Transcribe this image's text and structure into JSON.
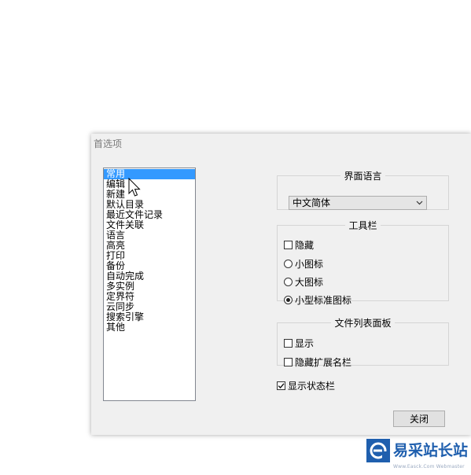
{
  "dialog": {
    "title": "首选项"
  },
  "categories": [
    "常用",
    "编辑",
    "新建",
    "默认目录",
    "最近文件记录",
    "文件关联",
    "语言",
    "高亮",
    "打印",
    "备份",
    "自动完成",
    "多实例",
    "定界符",
    "云同步",
    "搜索引擎",
    "其他"
  ],
  "selected_category": "常用",
  "language": {
    "legend": "界面语言",
    "value": "中文简体"
  },
  "toolbar": {
    "legend": "工具栏",
    "hide_label": "隐藏",
    "hide_checked": false,
    "options": [
      "小图标",
      "大图标",
      "小型标准图标"
    ],
    "selected": "小型标准图标"
  },
  "file_panel": {
    "legend": "文件列表面板",
    "show_label": "显示",
    "show_checked": false,
    "hide_ext_label": "隐藏扩展名栏",
    "hide_ext_checked": false
  },
  "status_bar": {
    "label": "显示状态栏",
    "checked": true
  },
  "close_label": "关闭",
  "watermark": {
    "text": "易采站长站",
    "sub": "Www.Easck.Com Webmaster"
  }
}
